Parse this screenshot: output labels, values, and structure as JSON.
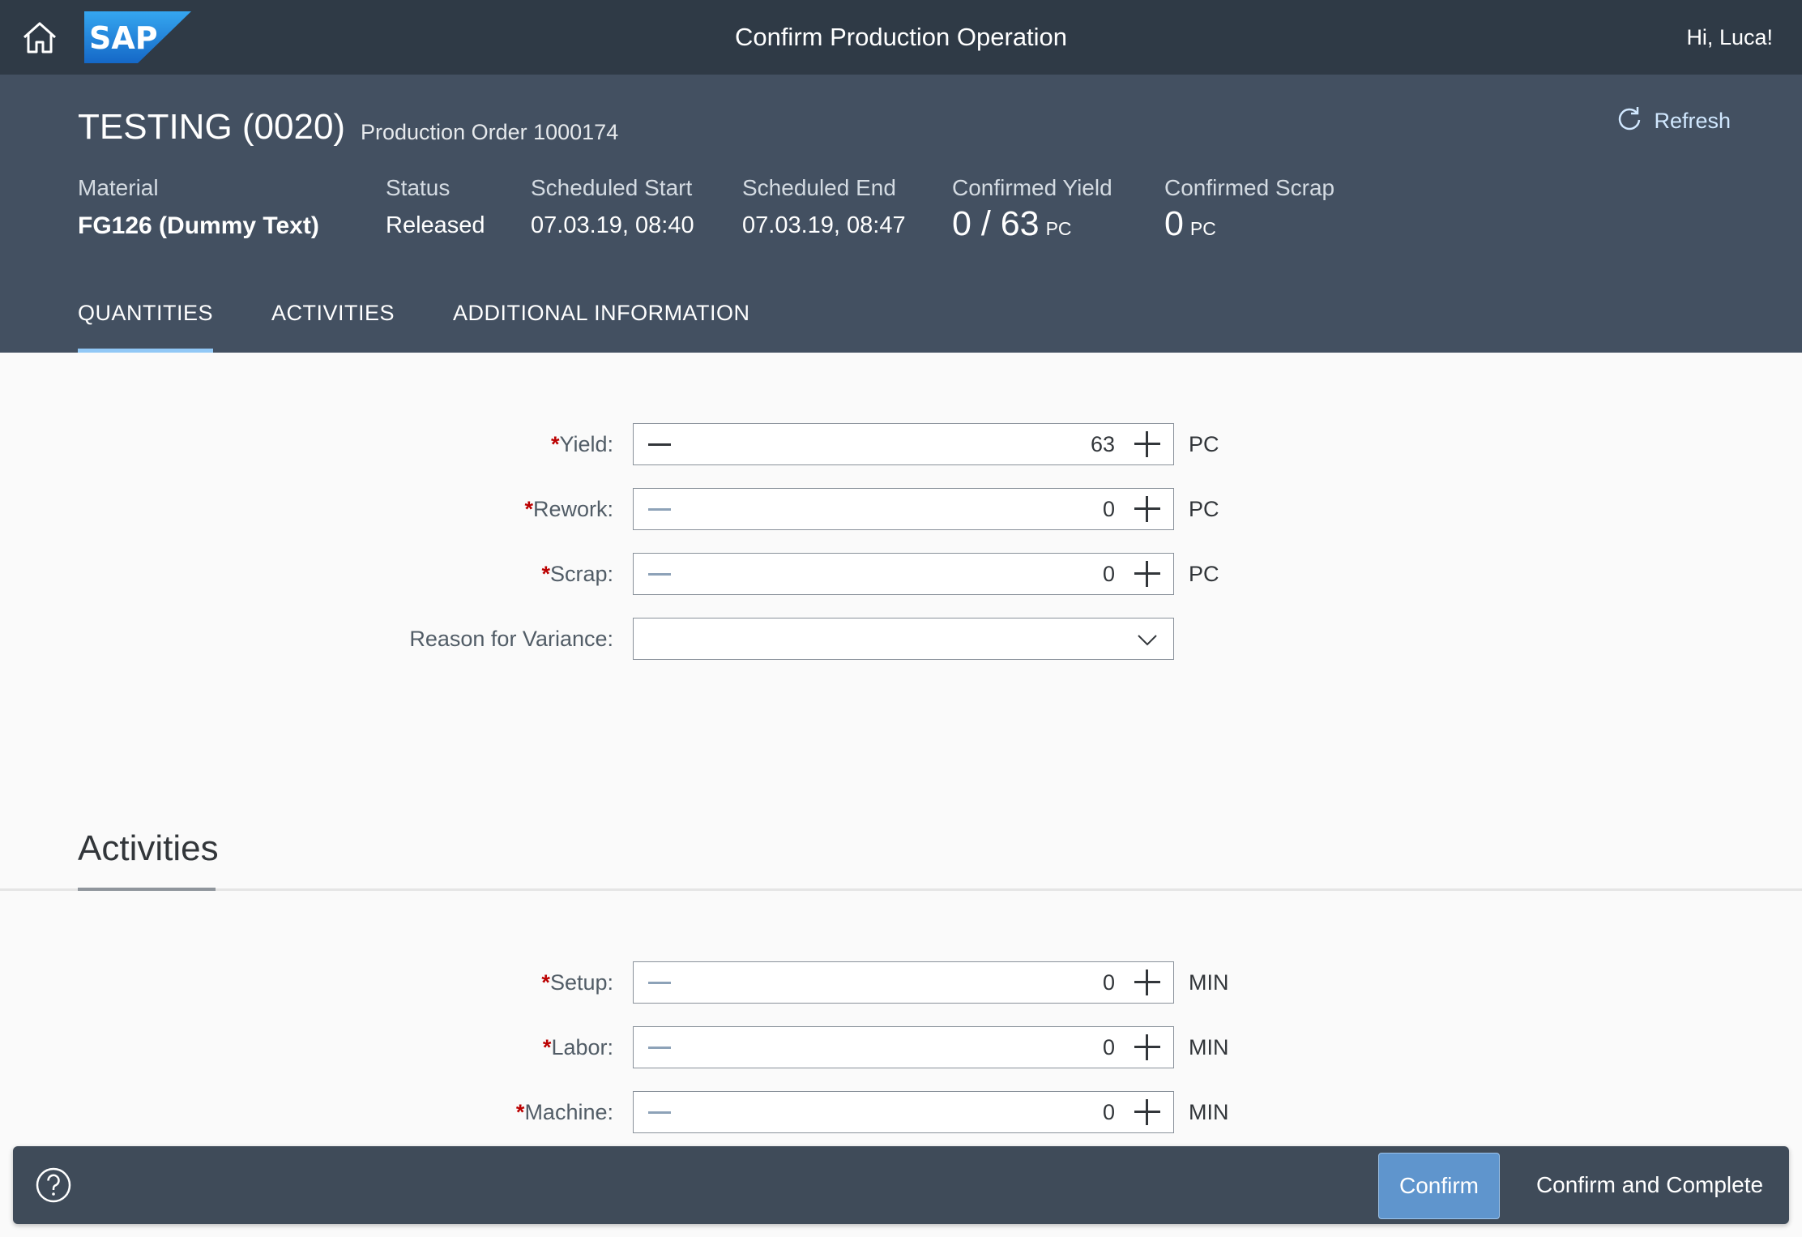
{
  "shell": {
    "logo_text": "SAP",
    "title": "Confirm Production Operation",
    "greeting": "Hi, Luca!",
    "brand_color": "#1a73d9"
  },
  "header": {
    "title": "TESTING (0020)",
    "subtitle": "Production Order 1000174",
    "refresh_label": "Refresh",
    "attributes": {
      "material_label": "Material",
      "material_value": "FG126 (Dummy Text)",
      "status_label": "Status",
      "status_value": "Released",
      "sched_start_label": "Scheduled Start",
      "sched_start_value": "07.03.19, 08:40",
      "sched_end_label": "Scheduled End",
      "sched_end_value": "07.03.19, 08:47",
      "yield_label": "Confirmed Yield",
      "yield_value": "0 / 63",
      "yield_unit": "PC",
      "scrap_label": "Confirmed Scrap",
      "scrap_value": "0",
      "scrap_unit": "PC"
    }
  },
  "tabs": [
    {
      "label": "QUANTITIES",
      "active": true
    },
    {
      "label": "ACTIVITIES",
      "active": false
    },
    {
      "label": "ADDITIONAL INFORMATION",
      "active": false
    }
  ],
  "quantities": {
    "required_mark": "*",
    "yield": {
      "label": "Yield:",
      "value": "63",
      "unit": "PC"
    },
    "rework": {
      "label": "Rework:",
      "value": "0",
      "unit": "PC"
    },
    "scrap": {
      "label": "Scrap:",
      "value": "0",
      "unit": "PC"
    },
    "variance": {
      "label": "Reason for Variance:",
      "value": ""
    }
  },
  "activities": {
    "title": "Activities",
    "setup": {
      "label": "Setup:",
      "value": "0",
      "unit": "MIN"
    },
    "labor": {
      "label": "Labor:",
      "value": "0",
      "unit": "MIN"
    },
    "machine": {
      "label": "Machine:",
      "value": "0",
      "unit": "MIN"
    }
  },
  "footer": {
    "confirm_label": "Confirm",
    "confirm_complete_label": "Confirm and Complete"
  }
}
